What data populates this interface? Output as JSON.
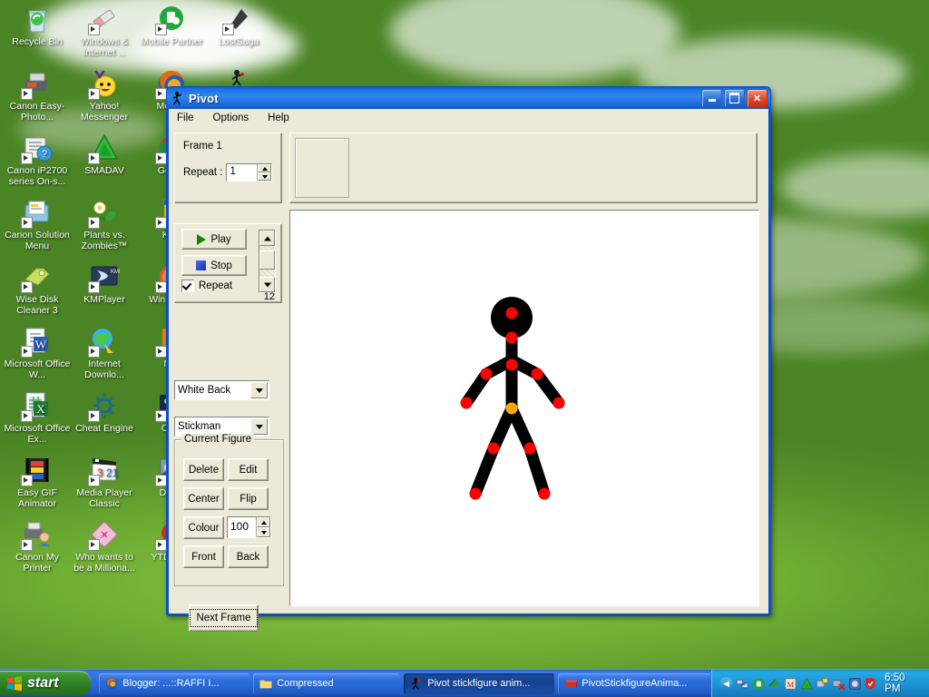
{
  "desktop": {
    "icons": [
      {
        "label": "Recycle Bin",
        "icon": "recycle-bin-icon",
        "shortcut": false,
        "col": 0,
        "row": 0
      },
      {
        "label": "Windows & Internet ...",
        "icon": "eraser-icon",
        "shortcut": true,
        "col": 1,
        "row": 0
      },
      {
        "label": "Mobile Partner",
        "icon": "mobile-partner-icon",
        "shortcut": true,
        "col": 2,
        "row": 0
      },
      {
        "label": "LostSaga",
        "icon": "lostsaga-icon",
        "shortcut": true,
        "col": 3,
        "row": 0
      },
      {
        "label": "Canon Easy-Photo...",
        "icon": "canon-printer-icon",
        "shortcut": true,
        "col": 0,
        "row": 1
      },
      {
        "label": "Yahoo! Messenger",
        "icon": "yahoo-messenger-icon",
        "shortcut": true,
        "col": 1,
        "row": 1
      },
      {
        "label": "Mozilla",
        "icon": "firefox-icon",
        "shortcut": true,
        "col": 2,
        "row": 1
      },
      {
        "label": "Canon iP2700 series On-s...",
        "icon": "manual-book-icon",
        "shortcut": true,
        "col": 0,
        "row": 2
      },
      {
        "label": "SMADAV",
        "icon": "smadav-icon",
        "shortcut": true,
        "col": 1,
        "row": 2
      },
      {
        "label": "Go Ch",
        "icon": "chrome-icon",
        "shortcut": true,
        "col": 2,
        "row": 2
      },
      {
        "label": "Canon Solution Menu",
        "icon": "canon-solution-icon",
        "shortcut": true,
        "col": 0,
        "row": 3
      },
      {
        "label": "Plants vs. Zombies™",
        "icon": "plants-vs-zombies-icon",
        "shortcut": true,
        "col": 1,
        "row": 3
      },
      {
        "label": "Kuis",
        "icon": "kuis-icon",
        "shortcut": true,
        "col": 2,
        "row": 3
      },
      {
        "label": "Wise Disk Cleaner 3",
        "icon": "wise-disk-cleaner-icon",
        "shortcut": true,
        "col": 0,
        "row": 4
      },
      {
        "label": "KMPlayer",
        "icon": "kmplayer-icon",
        "shortcut": true,
        "col": 1,
        "row": 4
      },
      {
        "label": "Win Media",
        "icon": "windows-media-player-icon",
        "shortcut": true,
        "col": 2,
        "row": 4
      },
      {
        "label": "Microsoft Office W...",
        "icon": "ms-word-icon",
        "shortcut": true,
        "col": 0,
        "row": 5
      },
      {
        "label": "Internet Downlo...",
        "icon": "internet-download-manager-icon",
        "shortcut": true,
        "col": 1,
        "row": 5
      },
      {
        "label": "Min",
        "icon": "min-icon",
        "shortcut": true,
        "col": 2,
        "row": 5
      },
      {
        "label": "Microsoft Office Ex...",
        "icon": "ms-excel-icon",
        "shortcut": true,
        "col": 0,
        "row": 6
      },
      {
        "label": "Cheat Engine",
        "icon": "cheat-engine-icon",
        "shortcut": true,
        "col": 1,
        "row": 6
      },
      {
        "label": "Catu",
        "icon": "catu-icon",
        "shortcut": true,
        "col": 2,
        "row": 6
      },
      {
        "label": "Easy GIF Animator",
        "icon": "easy-gif-animator-icon",
        "shortcut": true,
        "col": 0,
        "row": 7
      },
      {
        "label": "Media Player Classic",
        "icon": "media-player-classic-icon",
        "shortcut": true,
        "col": 1,
        "row": 7
      },
      {
        "label": "Deskt",
        "icon": "desktop-icon",
        "shortcut": true,
        "col": 2,
        "row": 7
      },
      {
        "label": "Canon My Printer",
        "icon": "canon-my-printer-icon",
        "shortcut": true,
        "col": 0,
        "row": 8
      },
      {
        "label": "Who wants to be a Milliona...",
        "icon": "millionaire-icon",
        "shortcut": true,
        "col": 1,
        "row": 8
      },
      {
        "label": "YTD Dow",
        "icon": "ytd-downloader-icon",
        "shortcut": true,
        "col": 2,
        "row": 8
      }
    ],
    "stray_stickman_icon": "pivot-stickman-desktop-icon"
  },
  "window": {
    "title": "Pivot",
    "title_icon": "pivot-stickman-icon",
    "controls": {
      "minimize": "minimize-button",
      "maximize": "maximize-button",
      "close": "close-button"
    },
    "menu": [
      "File",
      "Options",
      "Help"
    ]
  },
  "frame_panel": {
    "frame_label": "Frame 1",
    "repeat_label": "Repeat :",
    "repeat_value": "1"
  },
  "playback": {
    "play_label": "Play",
    "stop_label": "Stop",
    "repeat_label": "Repeat",
    "repeat_checked": true,
    "speed_value": "12"
  },
  "selectors": {
    "background": "White Back",
    "figure": "Stickman"
  },
  "current_figure": {
    "group_title": "Current Figure",
    "delete": "Delete",
    "edit": "Edit",
    "center": "Center",
    "flip": "Flip",
    "colour": "Colour",
    "colour_value": "100",
    "front": "Front",
    "back": "Back"
  },
  "next_frame_label": "Next Frame",
  "canvas": {
    "background_color": "#ffffff",
    "figure_limb_color": "#000000",
    "figure_joint_color": "#ff0000",
    "figure_origin_color": "#ffa500"
  },
  "taskbar": {
    "start_label": "start",
    "tasks": [
      {
        "label": "Blogger: ...::RAFFI I...",
        "icon": "firefox-icon",
        "active": false
      },
      {
        "label": "Compressed",
        "icon": "folder-icon",
        "active": false
      },
      {
        "label": "Pivot stickfigure anim...",
        "icon": "pivot-stickman-icon",
        "active": true
      },
      {
        "label": "PivotStickfigureAnima...",
        "icon": "winrar-icon",
        "active": false
      }
    ],
    "tray_icons": [
      "show-hidden-icons-chevron",
      "network-connections-icon",
      "antivirus-shield-icon",
      "smadav-icon",
      "idm-icon",
      "smadav-green-icon",
      "display-properties-icon",
      "safely-remove-hardware-icon",
      "security-center-icon",
      "red-shield-icon"
    ],
    "clock": "6:50 PM"
  },
  "colors": {
    "titlebar_blue": "#2f86f0",
    "taskbar_blue": "#2f6fdd",
    "start_green": "#3e9130",
    "window_face": "#ece9d8",
    "joint_red": "#ff0000",
    "origin_orange": "#ffa500"
  }
}
